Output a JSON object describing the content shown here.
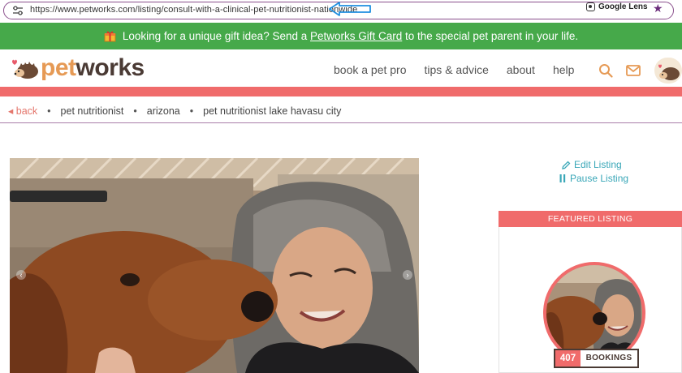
{
  "browser": {
    "url": "https://www.petworks.com/listing/consult-with-a-clinical-pet-nutritionist-nationwide",
    "lens_label": "Google Lens"
  },
  "banner": {
    "text_before": "Looking for a unique gift idea? Send a ",
    "link_text": "Petworks Gift Card",
    "text_after": " to the special pet parent in your life."
  },
  "logo": {
    "part1": "pet",
    "part2": "works"
  },
  "nav": {
    "items": [
      "book a pet pro",
      "tips & advice",
      "about",
      "help"
    ]
  },
  "breadcrumb": {
    "back": "back",
    "items": [
      "pet nutritionist",
      "arizona",
      "pet nutritionist lake havasu city"
    ]
  },
  "sidebar": {
    "edit": "Edit Listing",
    "pause": "Pause Listing",
    "featured_label": "FEATURED LISTING",
    "bookings_count": "407",
    "bookings_label": "BOOKINGS"
  },
  "colors": {
    "green": "#46a94a",
    "salmon": "#f06b6b",
    "teal": "#3aa7b8",
    "brand_orange": "#e69a55",
    "brand_brown": "#4a3a34"
  }
}
